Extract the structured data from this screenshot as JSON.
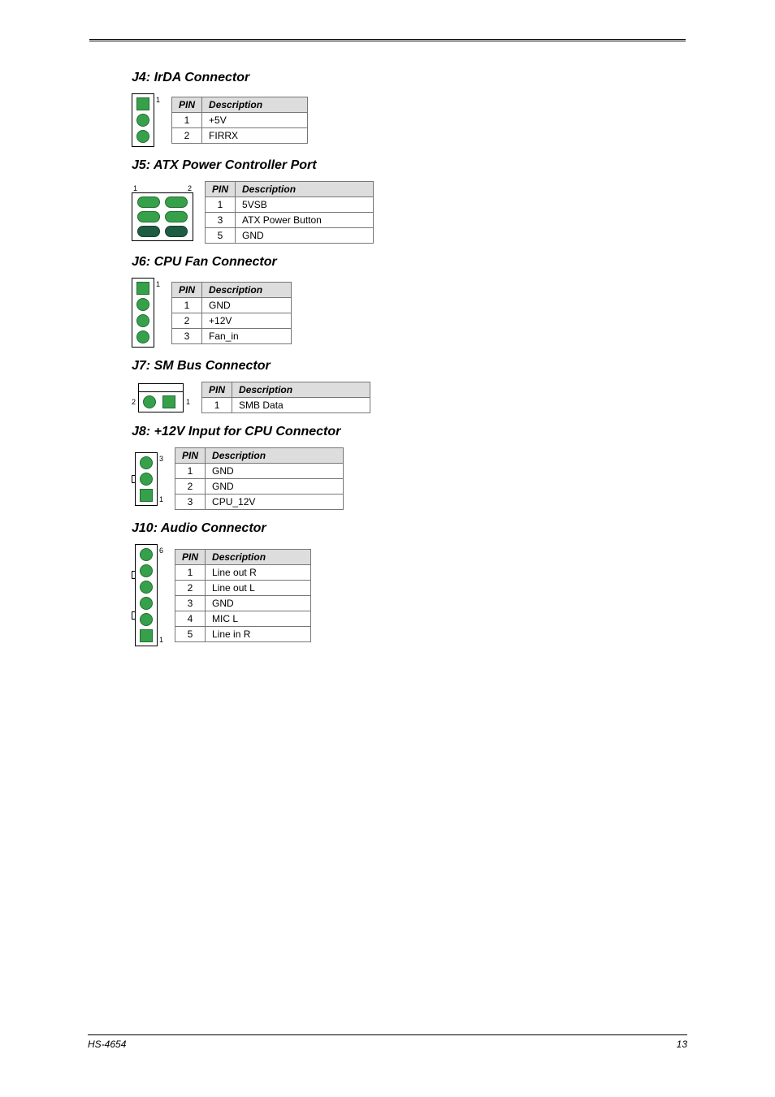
{
  "page": {
    "topic": "HS-4654",
    "footer_text": "HS-4654",
    "page_number": "13"
  },
  "sections": {
    "j4": {
      "title": "J4: IrDA Connector",
      "conn_label": "1",
      "headers": [
        "PIN",
        "Description"
      ],
      "rows": [
        [
          "1",
          "+5V"
        ],
        [
          "2",
          "FIRRX"
        ]
      ]
    },
    "j5": {
      "title": "J5: ATX Power Controller Port",
      "conn_label_left": "1",
      "conn_label_right": "2",
      "headers": [
        "PIN",
        "Description"
      ],
      "rows": [
        [
          "1",
          "5VSB"
        ],
        [
          "3",
          "ATX Power Button"
        ],
        [
          "5",
          "GND"
        ]
      ]
    },
    "j6": {
      "title": "J6: CPU Fan Connector",
      "conn_label": "1",
      "headers": [
        "PIN",
        "Description"
      ],
      "rows": [
        [
          "1",
          "GND"
        ],
        [
          "2",
          "+12V"
        ],
        [
          "3",
          "Fan_in"
        ]
      ]
    },
    "j7": {
      "title": "J7: SM Bus Connector",
      "conn_lbl2": "2",
      "conn_lbl1": "1",
      "headers": [
        "PIN",
        "Description"
      ],
      "rows": [
        [
          "1",
          "SMB Data"
        ]
      ]
    },
    "j8": {
      "title": "J8: +12V Input for CPU Connector",
      "conn_lbl_top": "3",
      "conn_lbl_bot": "1",
      "headers": [
        "PIN",
        "Description"
      ],
      "rows": [
        [
          "1",
          "GND"
        ],
        [
          "2",
          "GND"
        ],
        [
          "3",
          "CPU_12V"
        ]
      ]
    },
    "j10": {
      "title": "J10: Audio Connector",
      "conn_lbl_top": "6",
      "conn_lbl_bot": "1",
      "headers": [
        "PIN",
        "Description"
      ],
      "rows": [
        [
          "1",
          "Line out R"
        ],
        [
          "2",
          "Line out L"
        ],
        [
          "3",
          "GND"
        ],
        [
          "4",
          "MIC L"
        ],
        [
          "5",
          "Line in R"
        ]
      ]
    }
  }
}
